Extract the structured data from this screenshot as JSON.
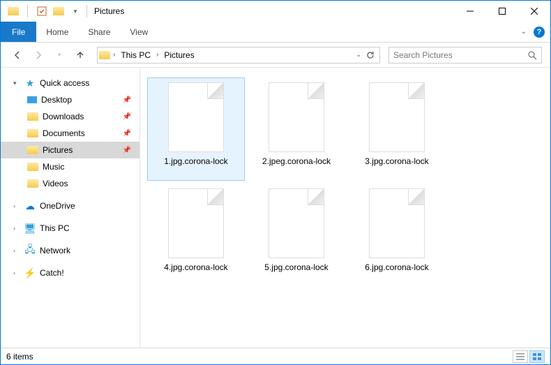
{
  "window": {
    "title": "Pictures"
  },
  "ribbon": {
    "file": "File",
    "tabs": [
      "Home",
      "Share",
      "View"
    ]
  },
  "breadcrumb": {
    "items": [
      "This PC",
      "Pictures"
    ]
  },
  "search": {
    "placeholder": "Search Pictures"
  },
  "sidebar": {
    "quick_access": "Quick access",
    "quick_items": [
      {
        "label": "Desktop",
        "pinned": true
      },
      {
        "label": "Downloads",
        "pinned": true
      },
      {
        "label": "Documents",
        "pinned": true
      },
      {
        "label": "Pictures",
        "pinned": true,
        "selected": true
      },
      {
        "label": "Music",
        "pinned": false
      },
      {
        "label": "Videos",
        "pinned": false
      }
    ],
    "onedrive": "OneDrive",
    "this_pc": "This PC",
    "network": "Network",
    "catch": "Catch!"
  },
  "files": [
    {
      "name": "1.jpg.corona-lock",
      "selected": true
    },
    {
      "name": "2.jpeg.corona-lock",
      "selected": false
    },
    {
      "name": "3.jpg.corona-lock",
      "selected": false
    },
    {
      "name": "4.jpg.corona-lock",
      "selected": false
    },
    {
      "name": "5.jpg.corona-lock",
      "selected": false
    },
    {
      "name": "6.jpg.corona-lock",
      "selected": false
    }
  ],
  "statusbar": {
    "count": "6 items"
  }
}
